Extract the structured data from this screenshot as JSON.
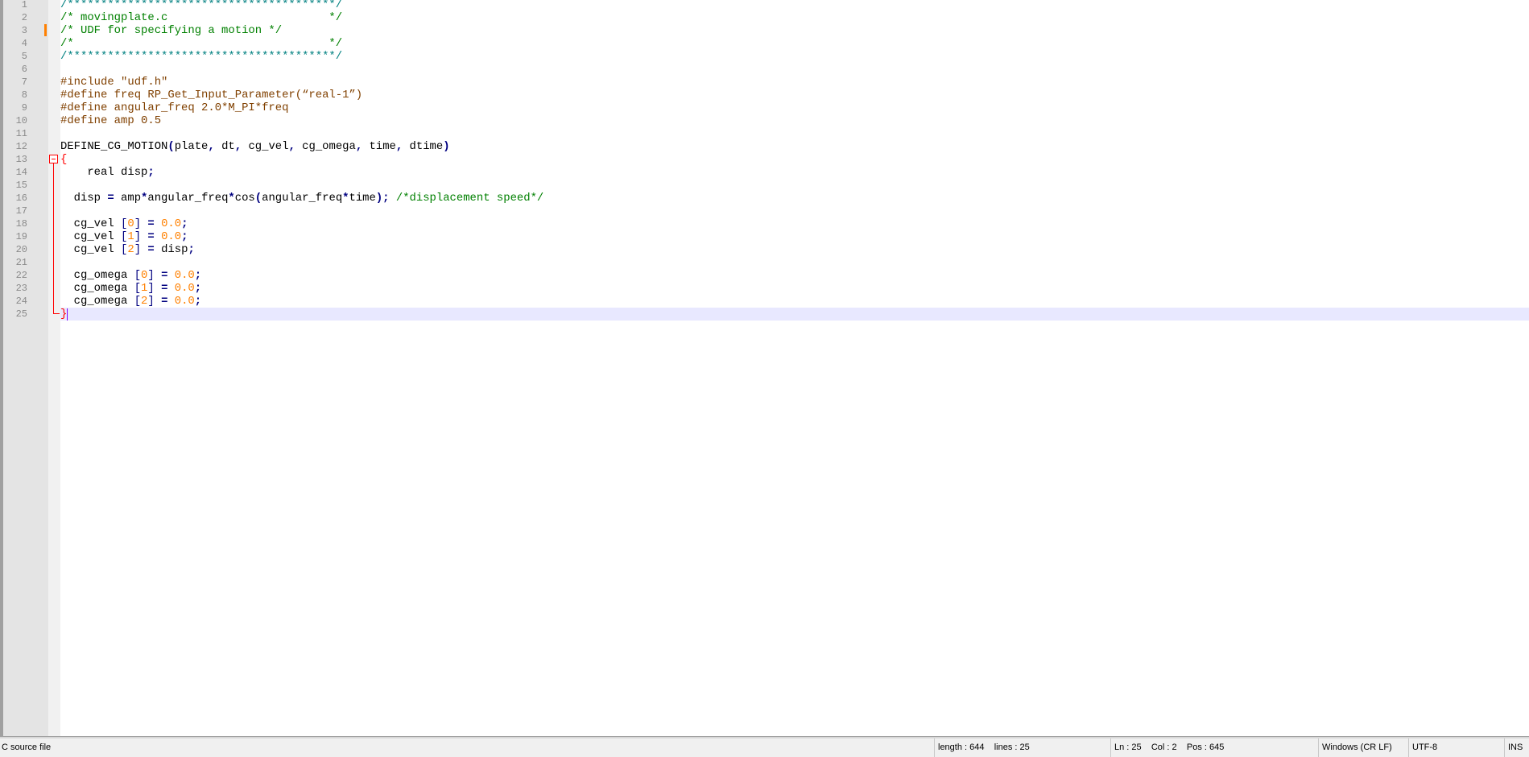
{
  "editor": {
    "lines": [
      [
        [
          "doc",
          "/****************************************/"
        ]
      ],
      [
        [
          "cmt",
          "/* movingplate.c                        */"
        ]
      ],
      [
        [
          "cmt",
          "/* UDF for specifying a motion */"
        ]
      ],
      [
        [
          "cmt",
          "/*                                      */"
        ]
      ],
      [
        [
          "doc",
          "/****************************************/"
        ]
      ],
      [],
      [
        [
          "pre",
          "#include \"udf.h\""
        ]
      ],
      [
        [
          "pre",
          "#define freq RP_Get_Input_Parameter(“real-1”)"
        ]
      ],
      [
        [
          "pre",
          "#define angular_freq 2.0*M_PI*freq"
        ]
      ],
      [
        [
          "pre",
          "#define amp 0.5"
        ]
      ],
      [],
      [
        [
          "d",
          "DEFINE_CG_MOTION"
        ],
        [
          "op",
          "("
        ],
        [
          "d",
          "plate"
        ],
        [
          "op",
          ","
        ],
        [
          "d",
          " dt"
        ],
        [
          "op",
          ","
        ],
        [
          "d",
          " cg_vel"
        ],
        [
          "op",
          ","
        ],
        [
          "d",
          " cg_omega"
        ],
        [
          "op",
          ","
        ],
        [
          "d",
          " time"
        ],
        [
          "op",
          ","
        ],
        [
          "d",
          " dtime"
        ],
        [
          "op",
          ")"
        ]
      ],
      [
        [
          "brace",
          "{"
        ]
      ],
      [
        [
          "d",
          "    real disp"
        ],
        [
          "op",
          ";"
        ]
      ],
      [],
      [
        [
          "d",
          "  disp "
        ],
        [
          "op",
          "="
        ],
        [
          "d",
          " amp"
        ],
        [
          "op",
          "*"
        ],
        [
          "d",
          "angular_freq"
        ],
        [
          "op",
          "*"
        ],
        [
          "d",
          "cos"
        ],
        [
          "op",
          "("
        ],
        [
          "d",
          "angular_freq"
        ],
        [
          "op",
          "*"
        ],
        [
          "d",
          "time"
        ],
        [
          "op",
          ");"
        ],
        [
          "d",
          " "
        ],
        [
          "cmt",
          "/*displacement speed*/"
        ]
      ],
      [],
      [
        [
          "d",
          "  cg_vel "
        ],
        [
          "br",
          "["
        ],
        [
          "num",
          "0"
        ],
        [
          "br",
          "]"
        ],
        [
          "d",
          " "
        ],
        [
          "op",
          "="
        ],
        [
          "d",
          " "
        ],
        [
          "num",
          "0.0"
        ],
        [
          "op",
          ";"
        ]
      ],
      [
        [
          "d",
          "  cg_vel "
        ],
        [
          "br",
          "["
        ],
        [
          "num",
          "1"
        ],
        [
          "br",
          "]"
        ],
        [
          "d",
          " "
        ],
        [
          "op",
          "="
        ],
        [
          "d",
          " "
        ],
        [
          "num",
          "0.0"
        ],
        [
          "op",
          ";"
        ]
      ],
      [
        [
          "d",
          "  cg_vel "
        ],
        [
          "br",
          "["
        ],
        [
          "num",
          "2"
        ],
        [
          "br",
          "]"
        ],
        [
          "d",
          " "
        ],
        [
          "op",
          "="
        ],
        [
          "d",
          " disp"
        ],
        [
          "op",
          ";"
        ]
      ],
      [],
      [
        [
          "d",
          "  cg_omega "
        ],
        [
          "br",
          "["
        ],
        [
          "num",
          "0"
        ],
        [
          "br",
          "]"
        ],
        [
          "d",
          " "
        ],
        [
          "op",
          "="
        ],
        [
          "d",
          " "
        ],
        [
          "num",
          "0.0"
        ],
        [
          "op",
          ";"
        ]
      ],
      [
        [
          "d",
          "  cg_omega "
        ],
        [
          "br",
          "["
        ],
        [
          "num",
          "1"
        ],
        [
          "br",
          "]"
        ],
        [
          "d",
          " "
        ],
        [
          "op",
          "="
        ],
        [
          "d",
          " "
        ],
        [
          "num",
          "0.0"
        ],
        [
          "op",
          ";"
        ]
      ],
      [
        [
          "d",
          "  cg_omega "
        ],
        [
          "br",
          "["
        ],
        [
          "num",
          "2"
        ],
        [
          "br",
          "]"
        ],
        [
          "d",
          " "
        ],
        [
          "op",
          "="
        ],
        [
          "d",
          " "
        ],
        [
          "num",
          "0.0"
        ],
        [
          "op",
          ";"
        ]
      ],
      [
        [
          "brace",
          "}"
        ]
      ]
    ],
    "current_line": 25
  },
  "status": {
    "file_type": "C source file",
    "length": "length : 644    lines : 25",
    "position": "Ln : 25    Col : 2    Pos : 645",
    "eol": "Windows (CR LF)",
    "encoding": "UTF-8",
    "mode": "INS"
  }
}
